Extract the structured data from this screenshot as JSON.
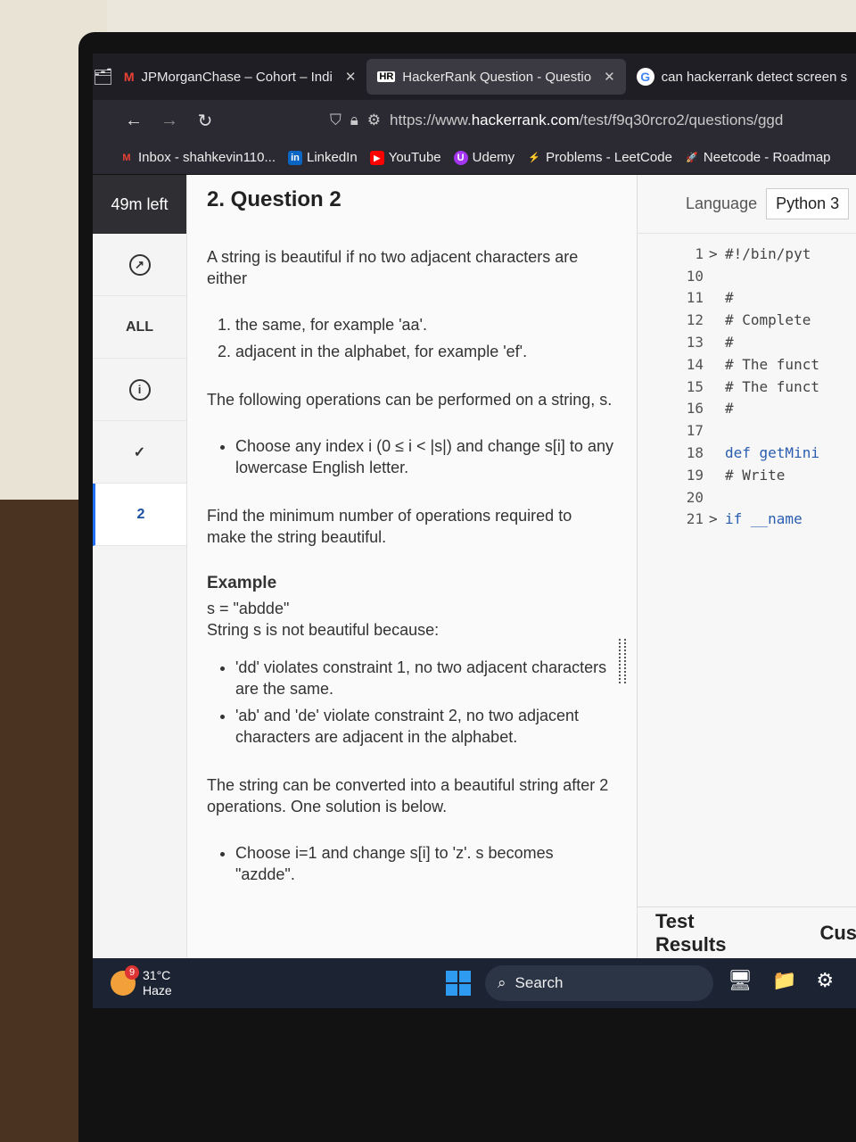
{
  "browser": {
    "tabs": [
      {
        "favicon": "M",
        "favicon_color": "#ea4335",
        "label": "JPMorganChase – Cohort – Indi",
        "close": "✕"
      },
      {
        "favicon": "HR",
        "favicon_color": "#ffffff",
        "label": "HackerRank Question - Questio",
        "close": "✕"
      },
      {
        "favicon": "G",
        "favicon_color": "#4285f4",
        "label": "can hackerrank detect screen s"
      }
    ],
    "url_prefix": "https://www.",
    "url_domain": "hackerrank.com",
    "url_path": "/test/f9q30rcro2/questions/ggd",
    "bookmarks": [
      {
        "icon": "M",
        "color": "#ea4335",
        "label": "Inbox - shahkevin110..."
      },
      {
        "icon": "in",
        "color": "#0a66c2",
        "label": "LinkedIn"
      },
      {
        "icon": "▶",
        "color": "#ff0000",
        "label": "YouTube"
      },
      {
        "icon": "U",
        "color": "#a435f0",
        "label": "Udemy"
      },
      {
        "icon": "⚡",
        "color": "#ffa116",
        "label": "Problems - LeetCode"
      },
      {
        "icon": "🚀",
        "color": "#444444",
        "label": "Neetcode - Roadmap"
      }
    ]
  },
  "sidebar": {
    "timer": "49m left",
    "all_label": "ALL",
    "current_question": "2"
  },
  "question": {
    "title": "2. Question 2",
    "intro": "A string is beautiful if no two adjacent characters are either",
    "rules": [
      "the same, for example 'aa'.",
      "adjacent in the alphabet, for example 'ef'."
    ],
    "ops_intro": "The following operations can be performed on a string, s.",
    "ops": [
      "Choose any index i (0 ≤ i < |s|) and change s[i] to any lowercase English letter."
    ],
    "task": "Find the minimum number of operations required to make the string beautiful.",
    "example_heading": "Example",
    "example_s": "s = \"abdde\"",
    "example_not": "String s is not beautiful because:",
    "violations": [
      "'dd' violates constraint 1, no two adjacent characters are the same.",
      "'ab' and 'de' violate constraint 2, no two adjacent characters are adjacent in the alphabet."
    ],
    "conversion": "The string can be converted into a beautiful string after 2 operations. One solution is below.",
    "solution_steps": [
      "Choose i=1 and change s[i] to 'z'. s becomes \"azdde\"."
    ]
  },
  "editor": {
    "language_label": "Language",
    "language_value": "Python 3",
    "lines": [
      {
        "n": "1",
        "fold": ">",
        "code": "#!/bin/pyt",
        "kw": false
      },
      {
        "n": "10",
        "fold": "",
        "code": "",
        "kw": false
      },
      {
        "n": "11",
        "fold": "",
        "code": "#",
        "kw": false
      },
      {
        "n": "12",
        "fold": "",
        "code": "# Complete",
        "kw": false
      },
      {
        "n": "13",
        "fold": "",
        "code": "#",
        "kw": false
      },
      {
        "n": "14",
        "fold": "",
        "code": "# The funct",
        "kw": false
      },
      {
        "n": "15",
        "fold": "",
        "code": "# The funct",
        "kw": false
      },
      {
        "n": "16",
        "fold": "",
        "code": "#",
        "kw": false
      },
      {
        "n": "17",
        "fold": "",
        "code": "",
        "kw": false
      },
      {
        "n": "18",
        "fold": "",
        "code": "def getMini",
        "kw": true
      },
      {
        "n": "19",
        "fold": "",
        "code": "    # Write",
        "kw": false
      },
      {
        "n": "20",
        "fold": "",
        "code": "",
        "kw": false
      },
      {
        "n": "21",
        "fold": ">",
        "code": "if __name",
        "kw": true
      }
    ],
    "test_results": "Test Results",
    "custom_tab": "Cus"
  },
  "taskbar": {
    "weather_temp": "31°C",
    "weather_desc": "Haze",
    "weather_badge": "9",
    "search_label": "Search"
  }
}
